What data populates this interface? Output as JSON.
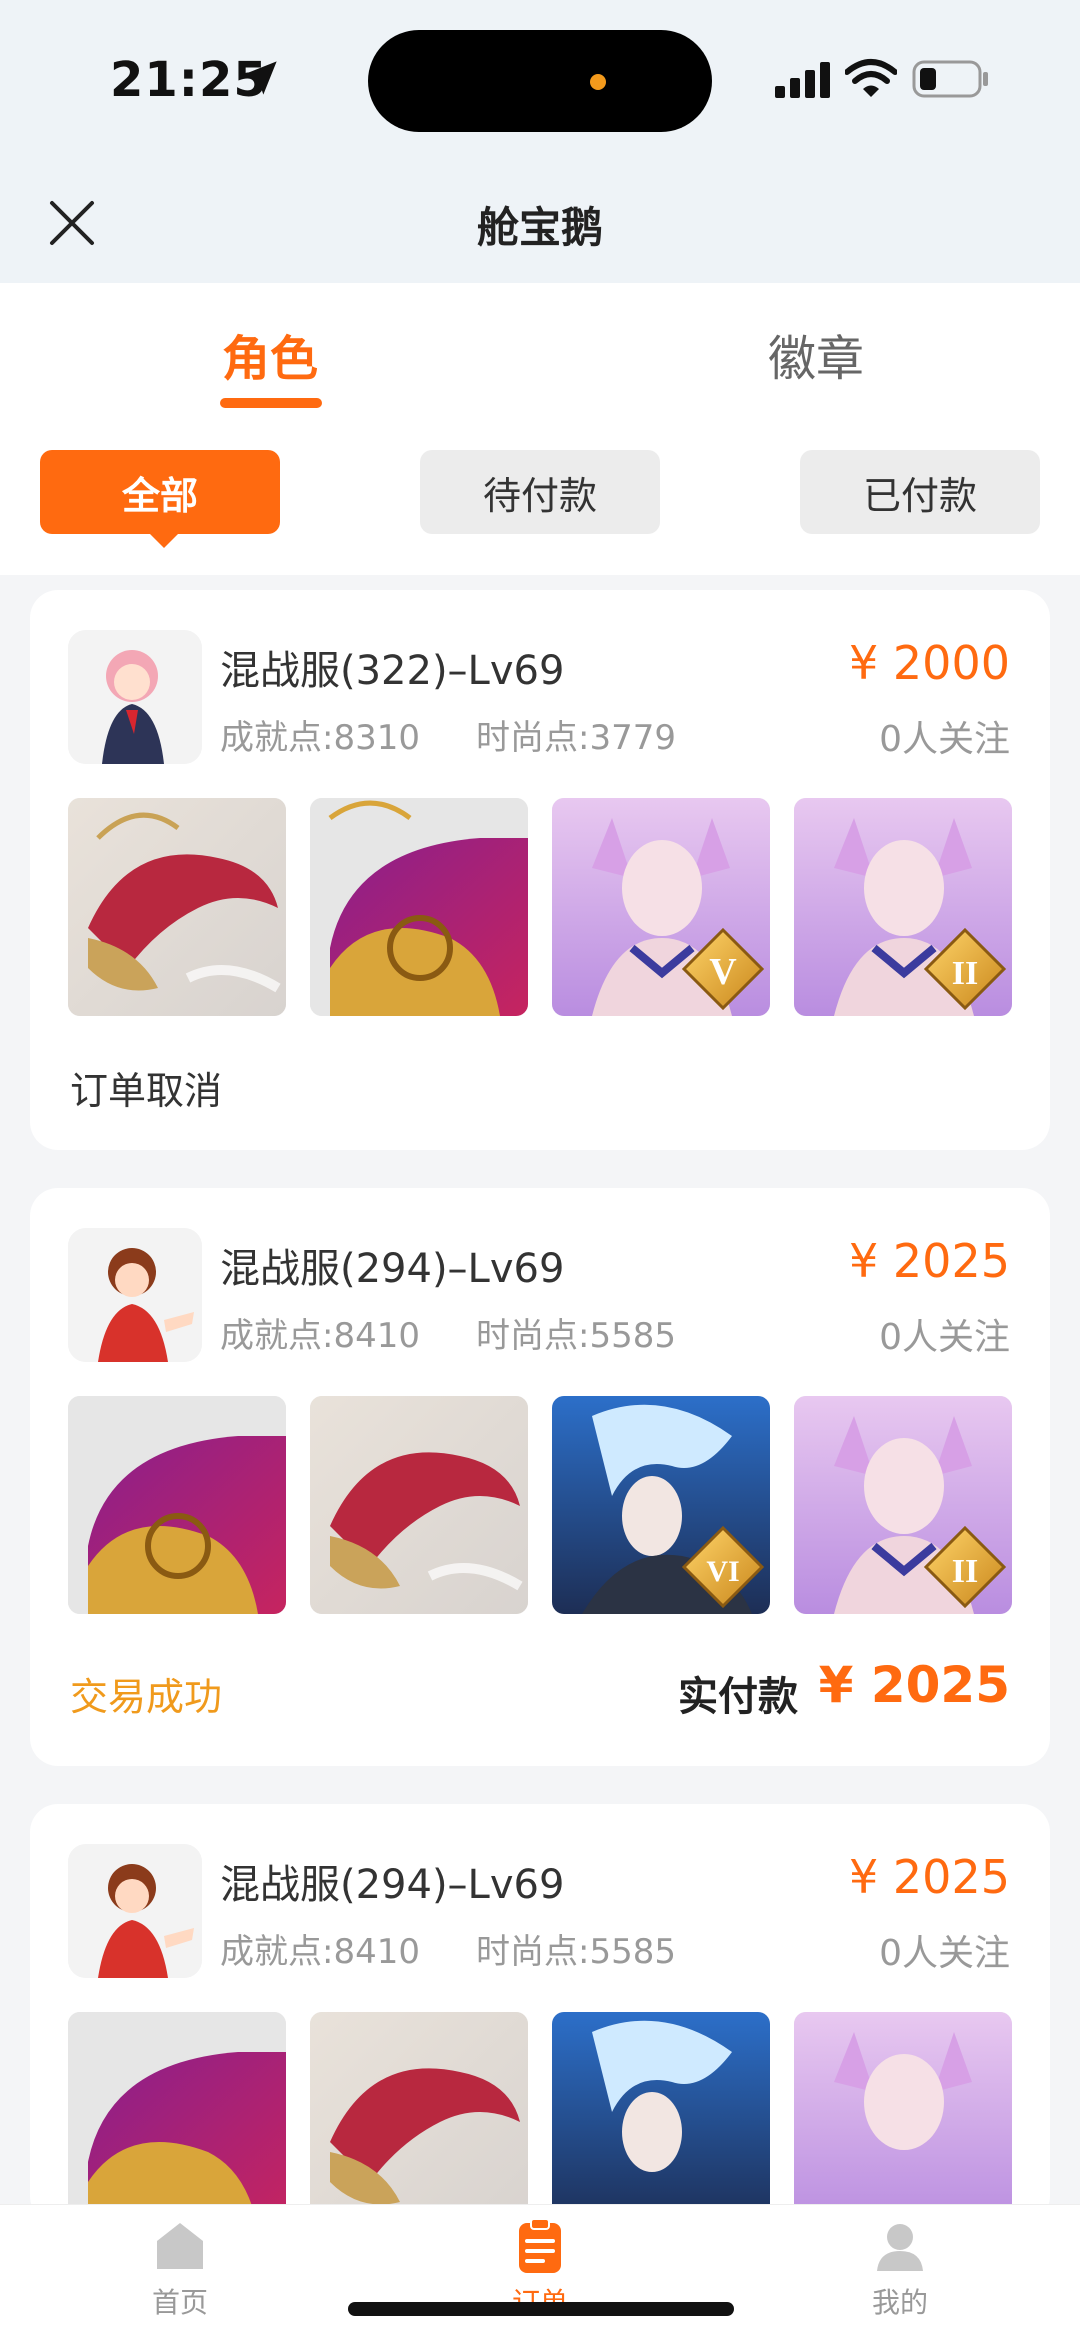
{
  "status_bar": {
    "time": "21:25"
  },
  "nav": {
    "title": "舱宝鹅"
  },
  "tabs": [
    {
      "label": "角色",
      "active": true
    },
    {
      "label": "徽章",
      "active": false
    }
  ],
  "filters": [
    {
      "label": "全部",
      "active": true
    },
    {
      "label": "待付款",
      "active": false
    },
    {
      "label": "已付款",
      "active": false
    }
  ],
  "orders": [
    {
      "server": "混战服(322)–Lv69",
      "achievement": "成就点:8310",
      "fashion": "时尚点:3779",
      "price": "¥ 2000",
      "followers": "0人关注",
      "status": "订单取消",
      "items": [
        "red-dragon",
        "golden-fish",
        "fox-girl-v",
        "fox-girl-ii"
      ]
    },
    {
      "server": "混战服(294)–Lv69",
      "achievement": "成就点:8410",
      "fashion": "时尚点:5585",
      "price": "¥ 2025",
      "followers": "0人关注",
      "status": "交易成功",
      "paid_label": "实付款",
      "paid_amount": "¥ 2025",
      "items": [
        "golden-fish",
        "red-dragon",
        "ice-warrior-vi",
        "fox-girl-ii"
      ]
    },
    {
      "server": "混战服(294)–Lv69",
      "achievement": "成就点:8410",
      "fashion": "时尚点:5585",
      "price": "¥ 2025",
      "followers": "0人关注",
      "items": [
        "golden-fish",
        "red-dragon",
        "ice-warrior-vi",
        "fox-girl-ii"
      ]
    }
  ],
  "bottom_nav": [
    {
      "label": "首页",
      "icon": "home-icon"
    },
    {
      "label": "订单",
      "icon": "orders-icon",
      "active": true
    },
    {
      "label": "我的",
      "icon": "profile-icon"
    }
  ],
  "colors": {
    "accent": "#ff6a10",
    "success": "#f09a1c"
  }
}
